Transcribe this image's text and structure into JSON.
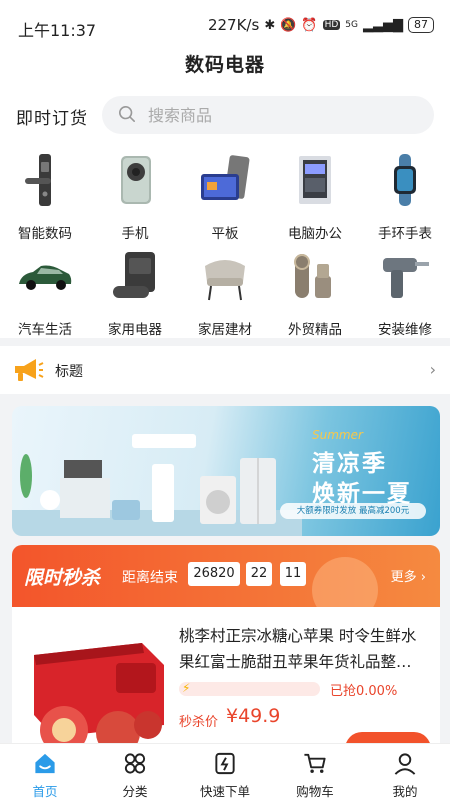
{
  "status": {
    "time": "上午11:37",
    "speed": "227K/s",
    "signal": "5G",
    "battery": "87"
  },
  "header": {
    "title": "数码电器"
  },
  "search": {
    "label": "即时订货",
    "placeholder": "搜索商品"
  },
  "categories": [
    {
      "label": "智能数码",
      "icon": "smart-lock-icon"
    },
    {
      "label": "手机",
      "icon": "phone-icon"
    },
    {
      "label": "平板",
      "icon": "tablet-icon"
    },
    {
      "label": "电脑办公",
      "icon": "computer-icon"
    },
    {
      "label": "手环手表",
      "icon": "watch-icon"
    },
    {
      "label": "汽车生活",
      "icon": "car-icon"
    },
    {
      "label": "家用电器",
      "icon": "robot-vacuum-icon"
    },
    {
      "label": "家居建材",
      "icon": "chair-icon"
    },
    {
      "label": "外贸精品",
      "icon": "purifier-icon"
    },
    {
      "label": "安装维修",
      "icon": "drill-icon"
    }
  ],
  "notice": {
    "title": "标题",
    "icon": "megaphone-icon"
  },
  "banner": {
    "script": "Summer",
    "line1": "清凉季",
    "line2": "焕新一夏",
    "sub": "大额券限时发放 最高减200元"
  },
  "flash": {
    "title": "限时秒杀",
    "countdown_label": "距离结束",
    "hours": "26820",
    "minutes": "22",
    "seconds": "11",
    "more": "更多"
  },
  "product": {
    "name": "桃李村正宗冰糖心苹果 时令生鲜水果红富士脆甜丑苹果年货礼品整…",
    "progress": 0.0,
    "sold": "已抢0.00%",
    "price_label": "秒杀价",
    "price": "¥49.9"
  },
  "tabs": [
    {
      "label": "首页",
      "icon": "home-icon",
      "active": true
    },
    {
      "label": "分类",
      "icon": "category-icon"
    },
    {
      "label": "快速下单",
      "icon": "quick-order-icon"
    },
    {
      "label": "购物车",
      "icon": "cart-icon"
    },
    {
      "label": "我的",
      "icon": "user-icon"
    }
  ],
  "colors": {
    "accent": "#2b9be8",
    "sale": "#f3552b"
  }
}
